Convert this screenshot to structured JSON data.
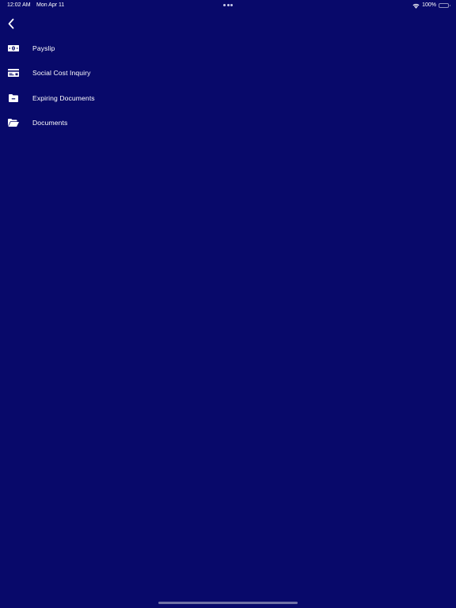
{
  "status_bar": {
    "time": "12:02 AM",
    "date": "Mon Apr 11",
    "battery_text": "100%",
    "battery_level": 1.0
  },
  "nav": {
    "back_icon": "chevron-left-icon"
  },
  "menu": {
    "items": [
      {
        "label": "Payslip",
        "icon": "money-bill-icon"
      },
      {
        "label": "Social Cost Inquiry",
        "icon": "credit-card-icon"
      },
      {
        "label": "Expiring Documents",
        "icon": "folder-minus-icon"
      },
      {
        "label": "Documents",
        "icon": "folder-open-icon"
      }
    ]
  },
  "colors": {
    "background": "#08096a",
    "text": "#ffffff"
  }
}
